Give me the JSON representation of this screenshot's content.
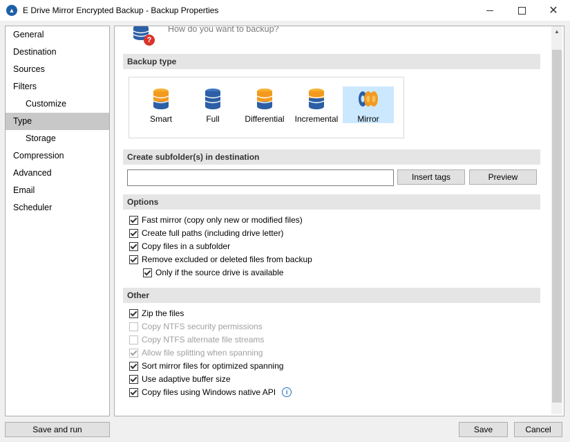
{
  "window": {
    "title": "E Drive Mirror Encrypted Backup - Backup Properties",
    "app_icon": "backup-app-icon",
    "minimize_icon": "minimize-icon",
    "maximize_icon": "maximize-icon",
    "close_icon": "close-icon"
  },
  "sidebar": {
    "items": [
      {
        "label": "General",
        "sub": false,
        "selected": false
      },
      {
        "label": "Destination",
        "sub": false,
        "selected": false
      },
      {
        "label": "Sources",
        "sub": false,
        "selected": false
      },
      {
        "label": "Filters",
        "sub": false,
        "selected": false
      },
      {
        "label": "Customize",
        "sub": true,
        "selected": false
      },
      {
        "label": "Type",
        "sub": false,
        "selected": true
      },
      {
        "label": "Storage",
        "sub": true,
        "selected": false
      },
      {
        "label": "Compression",
        "sub": false,
        "selected": false
      },
      {
        "label": "Advanced",
        "sub": false,
        "selected": false
      },
      {
        "label": "Email",
        "sub": false,
        "selected": false
      },
      {
        "label": "Scheduler",
        "sub": false,
        "selected": false
      }
    ]
  },
  "header": {
    "prompt": "How do you want to backup?"
  },
  "backup_type": {
    "section_label": "Backup type",
    "types": [
      {
        "label": "Smart",
        "icon": "database-orange-icon",
        "selected": false
      },
      {
        "label": "Full",
        "icon": "database-blue-icon",
        "selected": false
      },
      {
        "label": "Differential",
        "icon": "database-orange-icon",
        "selected": false
      },
      {
        "label": "Incremental",
        "icon": "database-orange-blue-icon",
        "selected": false
      },
      {
        "label": "Mirror",
        "icon": "mirror-discs-icon",
        "selected": true
      }
    ]
  },
  "subfolder": {
    "section_label": "Create subfolder(s) in destination",
    "input_value": "",
    "insert_tags_label": "Insert tags",
    "preview_label": "Preview"
  },
  "options": {
    "section_label": "Options",
    "items": [
      {
        "label": "Fast mirror (copy only new or modified files)",
        "checked": true,
        "disabled": false
      },
      {
        "label": "Create full paths (including drive letter)",
        "checked": true,
        "disabled": false
      },
      {
        "label": "Copy files in a subfolder",
        "checked": true,
        "disabled": false
      },
      {
        "label": "Remove excluded or deleted files from backup",
        "checked": true,
        "disabled": false
      },
      {
        "label": "Only if the source drive is available",
        "checked": true,
        "disabled": false
      }
    ]
  },
  "other": {
    "section_label": "Other",
    "items": [
      {
        "label": "Zip the files",
        "checked": true,
        "disabled": false
      },
      {
        "label": "Copy NTFS security permissions",
        "checked": false,
        "disabled": true
      },
      {
        "label": "Copy NTFS alternate file streams",
        "checked": false,
        "disabled": true
      },
      {
        "label": "Allow file splitting when spanning",
        "checked": true,
        "disabled": true
      },
      {
        "label": "Sort mirror files for optimized spanning",
        "checked": true,
        "disabled": false
      },
      {
        "label": "Use adaptive buffer size",
        "checked": true,
        "disabled": false
      },
      {
        "label": "Copy files using Windows native API",
        "checked": true,
        "disabled": false
      }
    ]
  },
  "footer": {
    "save_and_run_label": "Save and run",
    "save_label": "Save",
    "cancel_label": "Cancel"
  },
  "colors": {
    "selected_nav": "#c8c8c8",
    "selected_type": "#cce8ff",
    "section_header_bg": "#e5e5e5",
    "db_orange": "#f29a1f",
    "db_blue": "#2c5fa5"
  }
}
